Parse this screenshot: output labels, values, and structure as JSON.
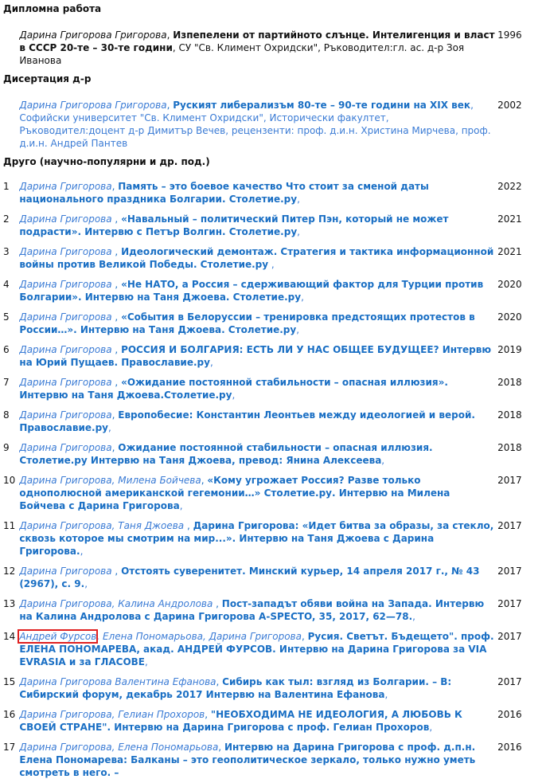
{
  "sections": {
    "diploma": {
      "title": "Дипломна работа"
    },
    "dissertation": {
      "title": "Дисертация д-р"
    },
    "other": {
      "title": "Друго (научно-популярни и др. под.)"
    }
  },
  "diploma_entry": {
    "author": "Дарина Григорова Григорова",
    "sep": ", ",
    "title": "Изпепелени от партийното слънце. Интелигенция и власт в СССР 20-те – 30-те години",
    "note": ", СУ \"Св. Климент Охридски\", Ръководител:гл. ас. д-р Зоя Иванова",
    "year": "1996"
  },
  "dissertation_entry": {
    "author": "Дарина Григорова Григорова",
    "sep": ", ",
    "title": "Руският либерализъм 80-те – 90-те години на XIX век",
    "note": ", Софийски университет \"Св. Климент Охридски\", Исторически факултет, Ръководител:доцент д-р Димитър Вечев, рецензенти: проф. д.и.н. Христина Мирчева, проф. д.и.н. Андрей Пантев",
    "year": "2002"
  },
  "entries": [
    {
      "n": "1",
      "authors": "Дарина Григорова",
      "sep": ", ",
      "title": "Память – это боевое качество Что стоит за сменой даты национального праздника Болгарии. Столетие.ру",
      "note": ",",
      "year": "2022"
    },
    {
      "n": "2",
      "authors": "Дарина Григорова",
      "sep": " , ",
      "title": "«Навальный – политический Питер Пэн, который не может подрасти». Интервю с Петър Волгин. Столетие.ру",
      "note": ",",
      "year": "2021"
    },
    {
      "n": "3",
      "authors": "Дарина Григорова",
      "sep": " , ",
      "title": "Идеологический демонтаж. Стратегия и тактика информационной войны против Великой Победы. Столетие.ру",
      "note": " ,",
      "year": "2021"
    },
    {
      "n": "4",
      "authors": "Дарина Григорова",
      "sep": " , ",
      "title": "«Не НАТО, а Россия – сдерживающий фактор для Турции против Болгарии». Интервю на Таня Джоева. Столетие.ру",
      "note": ",",
      "year": "2020"
    },
    {
      "n": "5",
      "authors": "Дарина Григорова",
      "sep": " , ",
      "title": "«События в Белоруссии – тренировка предстоящих протестов в России…». Интервю на Таня Джоева. Столетие.ру",
      "note": ",",
      "year": "2020"
    },
    {
      "n": "6",
      "authors": "Дарина Григорова",
      "sep": " , ",
      "title": "РОССИЯ И БОЛГАРИЯ: ЕСТЬ ЛИ У НАС ОБЩЕЕ БУДУЩЕЕ? Интервю на Юрий Пущаев. Православие.ру",
      "note": ",",
      "year": "2019"
    },
    {
      "n": "7",
      "authors": "Дарина Григорова",
      "sep": " , ",
      "title": "«Ожидание постоянной стабильности – опасная иллюзия». Интервю на Таня Джоева.Столетие.ру",
      "note": ",",
      "year": "2018"
    },
    {
      "n": "8",
      "authors": "Дарина Григорова",
      "sep": ", ",
      "title": "Европобесие: Константин Леонтьев между идеологией и верой. Православие.ру",
      "note": ",",
      "year": "2018"
    },
    {
      "n": "9",
      "authors": "Дарина Григорова",
      "sep": ", ",
      "title": "Ожидание постоянной стабильности – опасная иллюзия. Столетие.ру Интервю на Таня Джоева, превод: Янина Алексеева",
      "note": ",",
      "year": "2018"
    },
    {
      "n": "10",
      "authors": "Дарина Григорова, Милена Бойчева",
      "sep": ", ",
      "title": "«Кому угрожает Россия? Разве только однополюсной американской гегемонии…» Столетие.ру. Интервю на Милена Бойчева с Дарина Григорова",
      "note": ",",
      "year": "2017"
    },
    {
      "n": "11",
      "authors": "Дарина Григорова, Таня Джоева",
      "sep": " , ",
      "title": "Дарина Григорова: «Идет битва за образы, за стекло, сквозь которое мы смотрим на мир...». Интервю на Таня Джоева с Дарина Григорова.",
      "note": ",",
      "year": "2017"
    },
    {
      "n": "12",
      "authors": "Дарина Григорова",
      "sep": " , ",
      "title": "Отстоять суверенитет. Минский курьер, 14 апреля 2017 г., № 43 (2967), с. 9.",
      "note": ",",
      "year": "2017"
    },
    {
      "n": "13",
      "authors": "Дарина Григорова, Калина Андролова",
      "sep": " , ",
      "title": "Пост-западът обяви война на Запада. Интервю на Калина Андролова с Дарина Григорова A-SPECTO, 35, 2017, 62—78.",
      "note": ",",
      "year": "2017"
    },
    {
      "n": "14",
      "authors_hl": "Андрей Фурсов",
      "authors": ", Елена Пономарьова, Дарина Григорова",
      "sep": ", ",
      "title": "Русия. Светът. Бъдещето\". проф. ЕЛЕНА ПОНОМАРЕВА, акад. АНДРЕЙ ФУРСОВ. Интервю на Дарина Григорова за VIA EVRASIA и за ГЛАСОВЕ",
      "note": ",",
      "year": "2017"
    },
    {
      "n": "15",
      "authors": "Дарина Григорова Валентина Ефанова",
      "sep": ", ",
      "title": "Сибирь как тыл: взгляд из Болгарии. – В: Сибирский форум, декабрь 2017 Интервю на Валентина Ефанова",
      "note": ",",
      "year": "2017"
    },
    {
      "n": "16",
      "authors": "Дарина Григорова, Гелиан Прохоров",
      "sep": ", ",
      "title": "\"НЕОБХОДИМА НЕ ИДЕОЛОГИЯ, А ЛЮБОВЬ К СВОЕЙ СТРАНЕ\". Интервю на Дарина Григорова с проф. Гелиан Прохоров",
      "note": ",",
      "year": "2016"
    },
    {
      "n": "17",
      "authors": "Дарина Григорова, Елена Пономарьова",
      "sep": ", ",
      "title": "Интервю на Дарина Григорова с проф. д.п.н. Елена Пономарева: Балканы – это геополитическое зеркало, только нужно уметь смотреть в него. –",
      "note": "",
      "year": "2016"
    }
  ]
}
